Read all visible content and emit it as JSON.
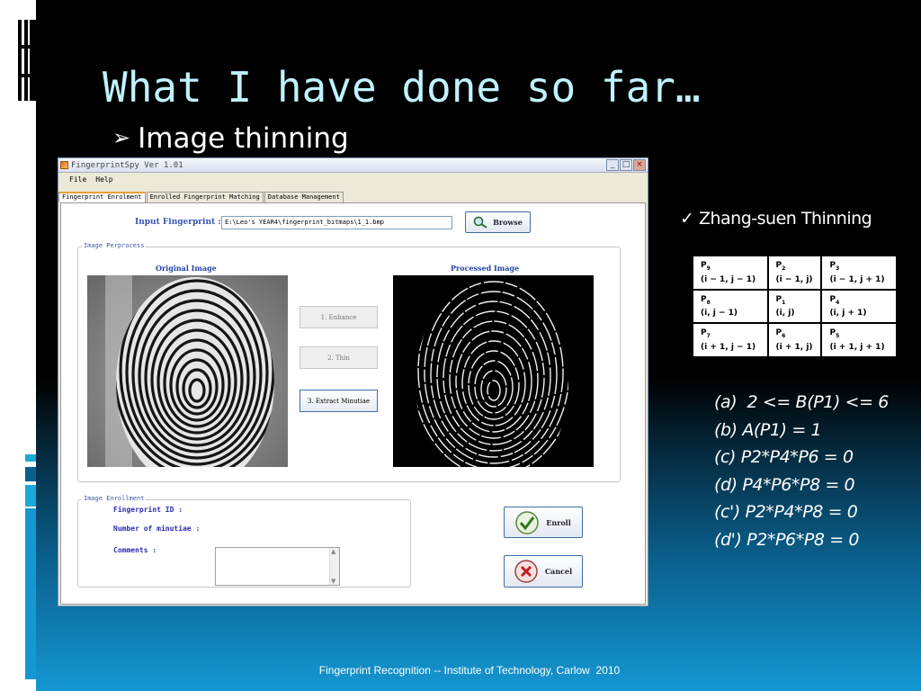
{
  "slide": {
    "title": "What I have done so far…",
    "bullet_arrow": "➢",
    "bullet": "Image thinning",
    "footer": "Fingerprint Recognition -- Institute of Technology, Carlow  2010"
  },
  "app": {
    "title": "FingerprintSpy Ver 1.01",
    "window_buttons": [
      "_",
      "□",
      "×"
    ],
    "menu": [
      "File",
      "Help"
    ],
    "tabs": [
      "Fingerprint Enrolment",
      "Enrolled Fingerprint Matching",
      "Database Management"
    ],
    "input_label": "Input Fingerprint :",
    "input_value": "E:\\Leo's YEAR4\\fingerprint_bitmaps\\1_1.bmp",
    "browse_label": "Browse",
    "preprocess_group": "Image Perprocess",
    "original_image_title": "Original Image",
    "processed_image_title": "Processed Image",
    "steps": [
      "1. Enhance",
      "2. Thin",
      "3. Extract Minutiae"
    ],
    "enroll_group": "Image Enrollment",
    "enroll_fields": [
      "Fingerprint ID :",
      "Number of minutiae :",
      "Comments :"
    ],
    "enroll_button": "Enroll",
    "cancel_button": "Cancel",
    "accent_color": "#3555b5"
  },
  "thinning": {
    "check_mark": "✓",
    "algorithm": "Zhang-suen Thinning",
    "neighborhood": [
      [
        {
          "p": "P9",
          "sub": "9",
          "pos": "(i − 1, j − 1)"
        },
        {
          "p": "P2",
          "sub": "2",
          "pos": "(i − 1, j)"
        },
        {
          "p": "P3",
          "sub": "3",
          "pos": "(i − 1, j + 1)"
        }
      ],
      [
        {
          "p": "P8",
          "sub": "8",
          "pos": "(i, j − 1)"
        },
        {
          "p": "P1",
          "sub": "1",
          "pos": "(i, j)"
        },
        {
          "p": "P4",
          "sub": "4",
          "pos": "(i, j + 1)"
        }
      ],
      [
        {
          "p": "P7",
          "sub": "7",
          "pos": "(i + 1, j − 1)"
        },
        {
          "p": "P6",
          "sub": "6",
          "pos": "(i + 1, j)"
        },
        {
          "p": "P5",
          "sub": "5",
          "pos": "(i + 1, j + 1)"
        }
      ]
    ],
    "conditions": [
      "(a)  2 <= B(P1) <= 6",
      "(b) A(P1) = 1",
      "(c) P2*P4*P6 = 0",
      "(d) P4*P6*P8 = 0",
      "(c') P2*P4*P8 = 0",
      "(d') P2*P6*P8 = 0"
    ]
  }
}
